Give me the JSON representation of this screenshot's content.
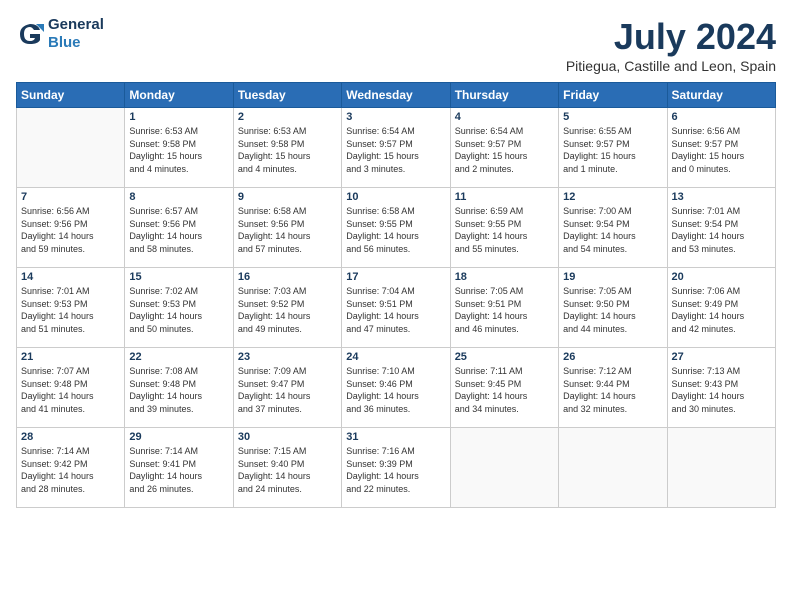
{
  "header": {
    "logo_line1": "General",
    "logo_line2": "Blue",
    "month_year": "July 2024",
    "location": "Pitiegua, Castille and Leon, Spain"
  },
  "weekdays": [
    "Sunday",
    "Monday",
    "Tuesday",
    "Wednesday",
    "Thursday",
    "Friday",
    "Saturday"
  ],
  "weeks": [
    [
      {
        "day": "",
        "info": ""
      },
      {
        "day": "1",
        "info": "Sunrise: 6:53 AM\nSunset: 9:58 PM\nDaylight: 15 hours\nand 4 minutes."
      },
      {
        "day": "2",
        "info": "Sunrise: 6:53 AM\nSunset: 9:58 PM\nDaylight: 15 hours\nand 4 minutes."
      },
      {
        "day": "3",
        "info": "Sunrise: 6:54 AM\nSunset: 9:57 PM\nDaylight: 15 hours\nand 3 minutes."
      },
      {
        "day": "4",
        "info": "Sunrise: 6:54 AM\nSunset: 9:57 PM\nDaylight: 15 hours\nand 2 minutes."
      },
      {
        "day": "5",
        "info": "Sunrise: 6:55 AM\nSunset: 9:57 PM\nDaylight: 15 hours\nand 1 minute."
      },
      {
        "day": "6",
        "info": "Sunrise: 6:56 AM\nSunset: 9:57 PM\nDaylight: 15 hours\nand 0 minutes."
      }
    ],
    [
      {
        "day": "7",
        "info": "Sunrise: 6:56 AM\nSunset: 9:56 PM\nDaylight: 14 hours\nand 59 minutes."
      },
      {
        "day": "8",
        "info": "Sunrise: 6:57 AM\nSunset: 9:56 PM\nDaylight: 14 hours\nand 58 minutes."
      },
      {
        "day": "9",
        "info": "Sunrise: 6:58 AM\nSunset: 9:56 PM\nDaylight: 14 hours\nand 57 minutes."
      },
      {
        "day": "10",
        "info": "Sunrise: 6:58 AM\nSunset: 9:55 PM\nDaylight: 14 hours\nand 56 minutes."
      },
      {
        "day": "11",
        "info": "Sunrise: 6:59 AM\nSunset: 9:55 PM\nDaylight: 14 hours\nand 55 minutes."
      },
      {
        "day": "12",
        "info": "Sunrise: 7:00 AM\nSunset: 9:54 PM\nDaylight: 14 hours\nand 54 minutes."
      },
      {
        "day": "13",
        "info": "Sunrise: 7:01 AM\nSunset: 9:54 PM\nDaylight: 14 hours\nand 53 minutes."
      }
    ],
    [
      {
        "day": "14",
        "info": "Sunrise: 7:01 AM\nSunset: 9:53 PM\nDaylight: 14 hours\nand 51 minutes."
      },
      {
        "day": "15",
        "info": "Sunrise: 7:02 AM\nSunset: 9:53 PM\nDaylight: 14 hours\nand 50 minutes."
      },
      {
        "day": "16",
        "info": "Sunrise: 7:03 AM\nSunset: 9:52 PM\nDaylight: 14 hours\nand 49 minutes."
      },
      {
        "day": "17",
        "info": "Sunrise: 7:04 AM\nSunset: 9:51 PM\nDaylight: 14 hours\nand 47 minutes."
      },
      {
        "day": "18",
        "info": "Sunrise: 7:05 AM\nSunset: 9:51 PM\nDaylight: 14 hours\nand 46 minutes."
      },
      {
        "day": "19",
        "info": "Sunrise: 7:05 AM\nSunset: 9:50 PM\nDaylight: 14 hours\nand 44 minutes."
      },
      {
        "day": "20",
        "info": "Sunrise: 7:06 AM\nSunset: 9:49 PM\nDaylight: 14 hours\nand 42 minutes."
      }
    ],
    [
      {
        "day": "21",
        "info": "Sunrise: 7:07 AM\nSunset: 9:48 PM\nDaylight: 14 hours\nand 41 minutes."
      },
      {
        "day": "22",
        "info": "Sunrise: 7:08 AM\nSunset: 9:48 PM\nDaylight: 14 hours\nand 39 minutes."
      },
      {
        "day": "23",
        "info": "Sunrise: 7:09 AM\nSunset: 9:47 PM\nDaylight: 14 hours\nand 37 minutes."
      },
      {
        "day": "24",
        "info": "Sunrise: 7:10 AM\nSunset: 9:46 PM\nDaylight: 14 hours\nand 36 minutes."
      },
      {
        "day": "25",
        "info": "Sunrise: 7:11 AM\nSunset: 9:45 PM\nDaylight: 14 hours\nand 34 minutes."
      },
      {
        "day": "26",
        "info": "Sunrise: 7:12 AM\nSunset: 9:44 PM\nDaylight: 14 hours\nand 32 minutes."
      },
      {
        "day": "27",
        "info": "Sunrise: 7:13 AM\nSunset: 9:43 PM\nDaylight: 14 hours\nand 30 minutes."
      }
    ],
    [
      {
        "day": "28",
        "info": "Sunrise: 7:14 AM\nSunset: 9:42 PM\nDaylight: 14 hours\nand 28 minutes."
      },
      {
        "day": "29",
        "info": "Sunrise: 7:14 AM\nSunset: 9:41 PM\nDaylight: 14 hours\nand 26 minutes."
      },
      {
        "day": "30",
        "info": "Sunrise: 7:15 AM\nSunset: 9:40 PM\nDaylight: 14 hours\nand 24 minutes."
      },
      {
        "day": "31",
        "info": "Sunrise: 7:16 AM\nSunset: 9:39 PM\nDaylight: 14 hours\nand 22 minutes."
      },
      {
        "day": "",
        "info": ""
      },
      {
        "day": "",
        "info": ""
      },
      {
        "day": "",
        "info": ""
      }
    ]
  ]
}
